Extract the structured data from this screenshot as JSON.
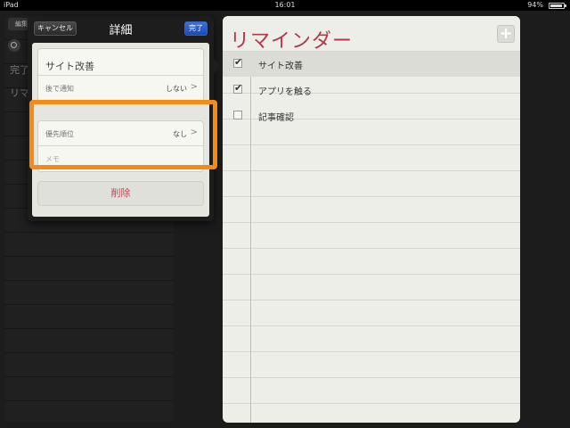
{
  "status_bar": {
    "carrier": "iPad",
    "time": "16:01",
    "battery": "94%"
  },
  "sidebar": {
    "edit_label": "編集",
    "items": [
      {
        "label": "完了"
      },
      {
        "label": "リマ"
      }
    ]
  },
  "popover": {
    "cancel_label": "キャンセル",
    "title": "詳細",
    "done_label": "完了",
    "name_value": "サイト改善",
    "remind_label": "後で通知",
    "remind_value": "しない",
    "priority_label": "優先順位",
    "priority_value": "なし",
    "memo_placeholder": "メモ",
    "delete_label": "削除"
  },
  "notepad": {
    "title": "リマインダー",
    "add_label": "+",
    "reminders": [
      {
        "label": "サイト改善",
        "checked": true
      },
      {
        "label": "アプリを触る",
        "checked": true
      },
      {
        "label": "記事確認",
        "checked": false
      }
    ]
  },
  "colors": {
    "highlight": "#f58a14",
    "title_red": "#b23a4a",
    "done_blue": "#1c4bb3"
  }
}
